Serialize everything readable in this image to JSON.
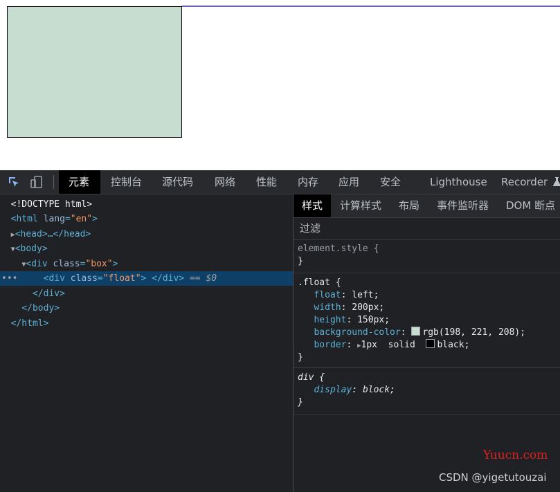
{
  "page": {
    "float_box_color": "#c6ddd0"
  },
  "devtools": {
    "tabs": [
      "元素",
      "控制台",
      "源代码",
      "网络",
      "性能",
      "内存",
      "应用",
      "安全",
      "Lighthouse",
      "Recorder"
    ],
    "active_tab": "元素",
    "dom": {
      "doctype": "<!DOCTYPE html>",
      "html_open_tag": "html",
      "html_attr_name": "lang",
      "html_attr_value": "\"en\"",
      "head_collapsed": "<head>…</head>",
      "body_open": "<body>",
      "div_box_tag": "div",
      "div_box_attr_name": "class",
      "div_box_attr_value": "\"box\"",
      "div_float_tag": "div",
      "div_float_attr_name": "class",
      "div_float_attr_value": "\"float\"",
      "div_float_close": "</div>",
      "selected_marker": "== $0",
      "div_close": "</div>",
      "body_close": "</body>",
      "html_close": "</html>"
    },
    "styles_tabs": [
      "样式",
      "计算样式",
      "布局",
      "事件监听器",
      "DOM 断点"
    ],
    "filter_label": "过滤",
    "rules": {
      "element_style_selector": "element.style {",
      "float_selector": ".float {",
      "float_props": [
        {
          "name": "float",
          "value": "left;"
        },
        {
          "name": "width",
          "value": "200px;"
        },
        {
          "name": "height",
          "value": "150px;"
        },
        {
          "name": "background-color",
          "value": "rgb(198, 221, 208);"
        },
        {
          "name": "border",
          "value": "1px  solid  black;"
        }
      ],
      "div_selector": "div {",
      "div_props": [
        {
          "name": "display",
          "value": "block;"
        }
      ],
      "close_brace": "}"
    },
    "watermark_site": "Yuucn.com",
    "watermark_author": "CSDN @yigetutouzai"
  }
}
